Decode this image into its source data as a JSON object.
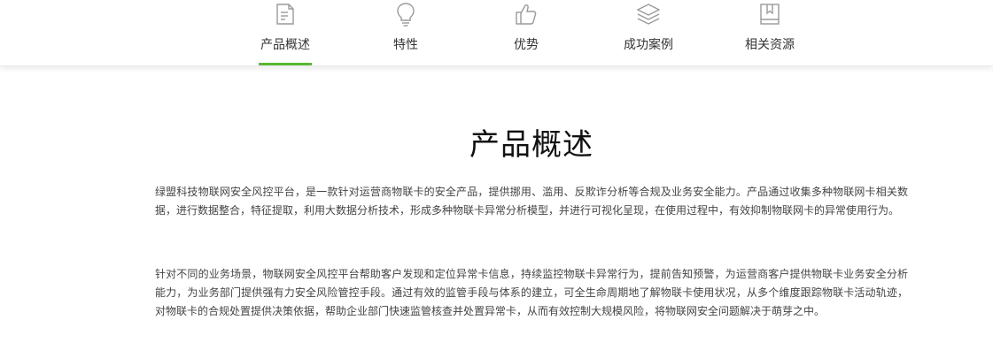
{
  "nav": {
    "items": [
      {
        "label": "产品概述",
        "icon": "document-icon",
        "active": true
      },
      {
        "label": "特性",
        "icon": "lightbulb-icon",
        "active": false
      },
      {
        "label": "优势",
        "icon": "thumbs-up-icon",
        "active": false
      },
      {
        "label": "成功案例",
        "icon": "layers-icon",
        "active": false
      },
      {
        "label": "相关资源",
        "icon": "book-icon",
        "active": false
      }
    ],
    "active_color": "#58b832"
  },
  "main": {
    "title": "产品概述",
    "paragraphs": [
      "绿盟科技物联网安全风控平台，是一款针对运营商物联卡的安全产品，提供挪用、滥用、反欺诈分析等合规及业务安全能力。产品通过收集多种物联网卡相关数据，进行数据整合，特征提取，利用大数据分析技术，形成多种物联卡异常分析模型，并进行可视化呈现，在使用过程中，有效抑制物联网卡的异常使用行为。",
      "针对不同的业务场景，物联网安全风控平台帮助客户发现和定位异常卡信息，持续监控物联卡异常行为，提前告知预警，为运营商客户提供物联卡业务安全分析能力，为业务部门提供强有力安全风险管控手段。通过有效的监管手段与体系的建立，可全生命周期地了解物联卡使用状况，从多个维度跟踪物联卡活动轨迹，对物联卡的合规处置提供决策依据，帮助企业部门快速监管核查并处置异常卡，从而有效控制大规模风险，将物联网安全问题解决于萌芽之中。"
    ]
  }
}
